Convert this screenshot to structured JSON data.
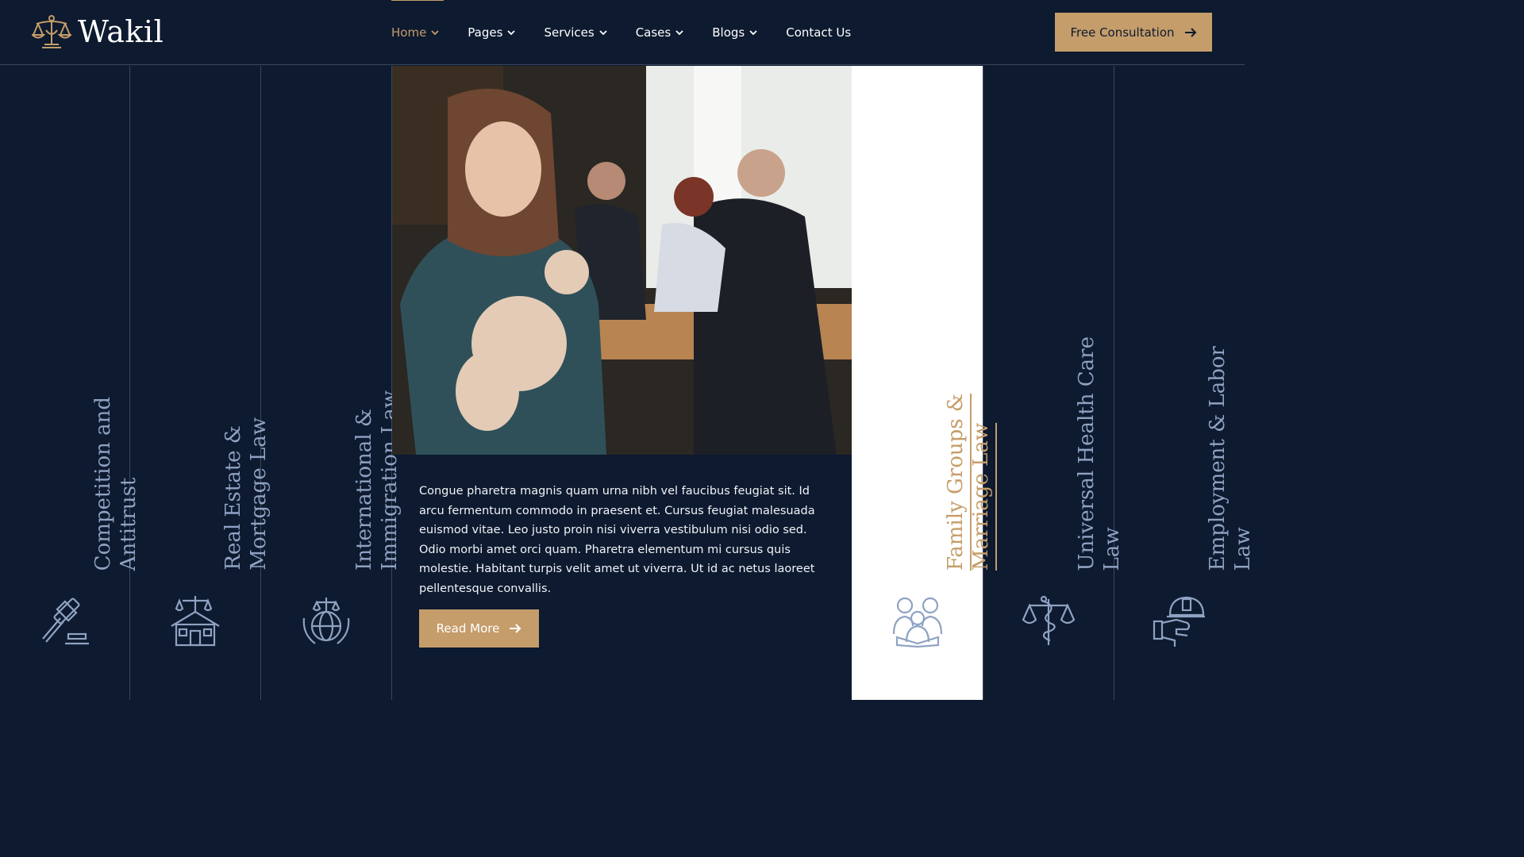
{
  "brand": {
    "name": "Wakil",
    "accent": "#c59d6a",
    "background": "#0d1a2f",
    "icon": "scales-of-justice-icon"
  },
  "nav": {
    "items": [
      {
        "label": "Home",
        "has_dropdown": true,
        "active": true
      },
      {
        "label": "Pages",
        "has_dropdown": true
      },
      {
        "label": "Services",
        "has_dropdown": true
      },
      {
        "label": "Cases",
        "has_dropdown": true
      },
      {
        "label": "Blogs",
        "has_dropdown": true
      },
      {
        "label": "Contact Us",
        "has_dropdown": false
      }
    ],
    "cta_label": "Free Consultation"
  },
  "practice_areas": [
    {
      "label": "Competition and\nAntitrust",
      "icon": "gavel-icon"
    },
    {
      "label": "Real Estate &\nMortgage Law",
      "icon": "house-scales-icon"
    },
    {
      "label": "International &\nImmigration Law",
      "icon": "globe-scales-icon"
    },
    {
      "label": "Family Groups &\nMarriage Law",
      "icon": "family-icon",
      "highlighted": true
    },
    {
      "label": "Universal Health Care\nLaw",
      "icon": "caduceus-scales-icon"
    },
    {
      "label": "Employment & Labor\nLaw",
      "icon": "hardhat-hand-icon"
    }
  ],
  "featured": {
    "description": "Congue pharetra magnis quam urna nibh vel faucibus feugiat sit. Id arcu fermentum commodo in praesent et. Cursus feugiat malesuada euismod vitae. Leo justo proin nisi viverra vestibulum nisi odio sed. Odio morbi amet orci quam. Pharetra elementum mi cursus quis molestie. Habitant turpis velit amet ut viverra. Ut id ac netus laoreet pellentesque convallis.",
    "button_label": "Read More"
  }
}
